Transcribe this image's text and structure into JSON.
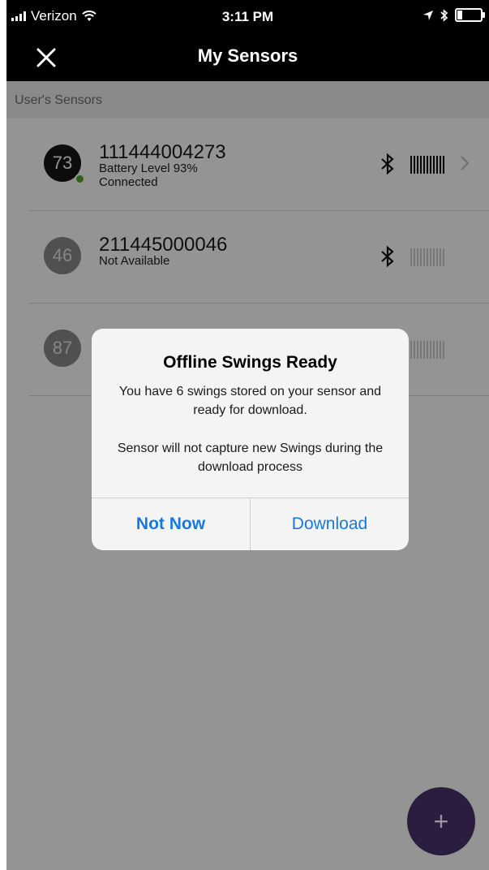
{
  "status_bar": {
    "carrier": "Verizon",
    "time": "3:11 PM"
  },
  "nav": {
    "title": "My Sensors",
    "close_icon": "close-icon"
  },
  "section": {
    "header": "User's Sensors"
  },
  "sensors": [
    {
      "badge": "73",
      "id": "111444004273",
      "line1": "Battery Level 93%",
      "line2": "Connected",
      "status_color": "#5ba534"
    },
    {
      "badge": "46",
      "id": "211445000046",
      "line1": "Not Available"
    },
    {
      "badge": "87",
      "id": ""
    }
  ],
  "alert": {
    "title": "Offline Swings Ready",
    "message": "You have 6 swings stored on your sensor and ready for download.",
    "warning": "Sensor will not capture new Swings during the download process",
    "cancel_label": "Not Now",
    "confirm_label": "Download"
  },
  "fab": {
    "label": "+"
  },
  "colors": {
    "accent_blue": "#1779e0",
    "fab_purple": "#2a1d3e",
    "connected_green": "#5ba534"
  }
}
